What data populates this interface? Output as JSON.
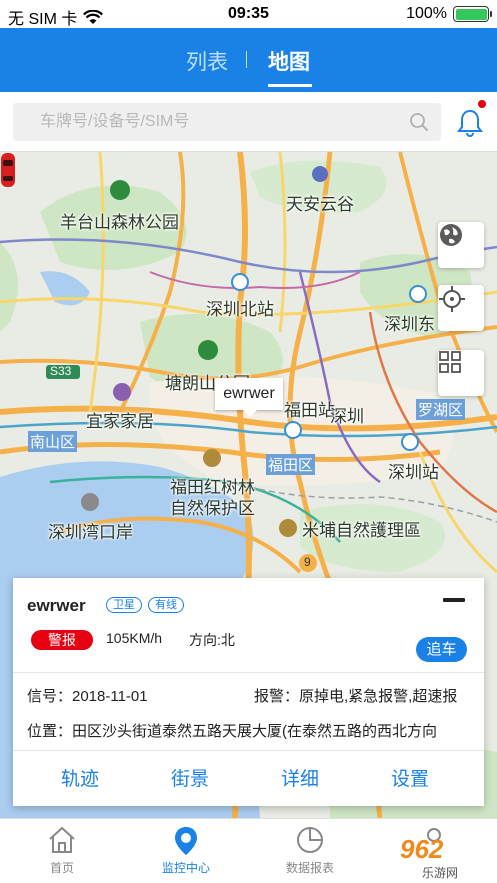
{
  "status_bar": {
    "carrier": "无 SIM 卡",
    "time": "09:35",
    "battery": "100%",
    "battery_level": 1.0
  },
  "nav": {
    "tab_list": "列表",
    "tab_map": "地图",
    "divider": "|"
  },
  "search": {
    "placeholder": "车牌号/设备号/SIM号",
    "value": ""
  },
  "map": {
    "labels": [
      "羊台山森林公园",
      "天安云谷",
      "深圳北站",
      "深圳东",
      "塘朗山公园",
      "宜家家居",
      "福田站",
      "深圳",
      "罗湖区",
      "南山区",
      "福田区",
      "深圳站",
      "福田红树林",
      "自然保护区",
      "深圳湾口岸",
      "米埔自然護理區",
      "S33",
      "9"
    ]
  },
  "car_tooltip": "ewrwer",
  "info": {
    "name": "ewrwer",
    "tag_sat": "卫星",
    "tag_wired": "有线",
    "alarm": "警报",
    "speed": "105KM/h",
    "direction": "方向:北",
    "chase": "追车",
    "signal": "信号：2018-11-01",
    "alarm_detail": "报警：原掉电,紧急报警,超速报",
    "location": "位置：田区沙头街道泰然五路天展大厦(在泰然五路的西北方向",
    "actions": [
      "轨迹",
      "街景",
      "详细",
      "设置"
    ]
  },
  "tabbar": {
    "items": [
      "首页",
      "监控中心",
      "数据报表",
      ""
    ]
  },
  "watermark": {
    "text": "962",
    "sub": "乐游网"
  },
  "colors": {
    "brand": "#1a82e6",
    "alarm": "#e60012",
    "battery": "#34c759"
  }
}
